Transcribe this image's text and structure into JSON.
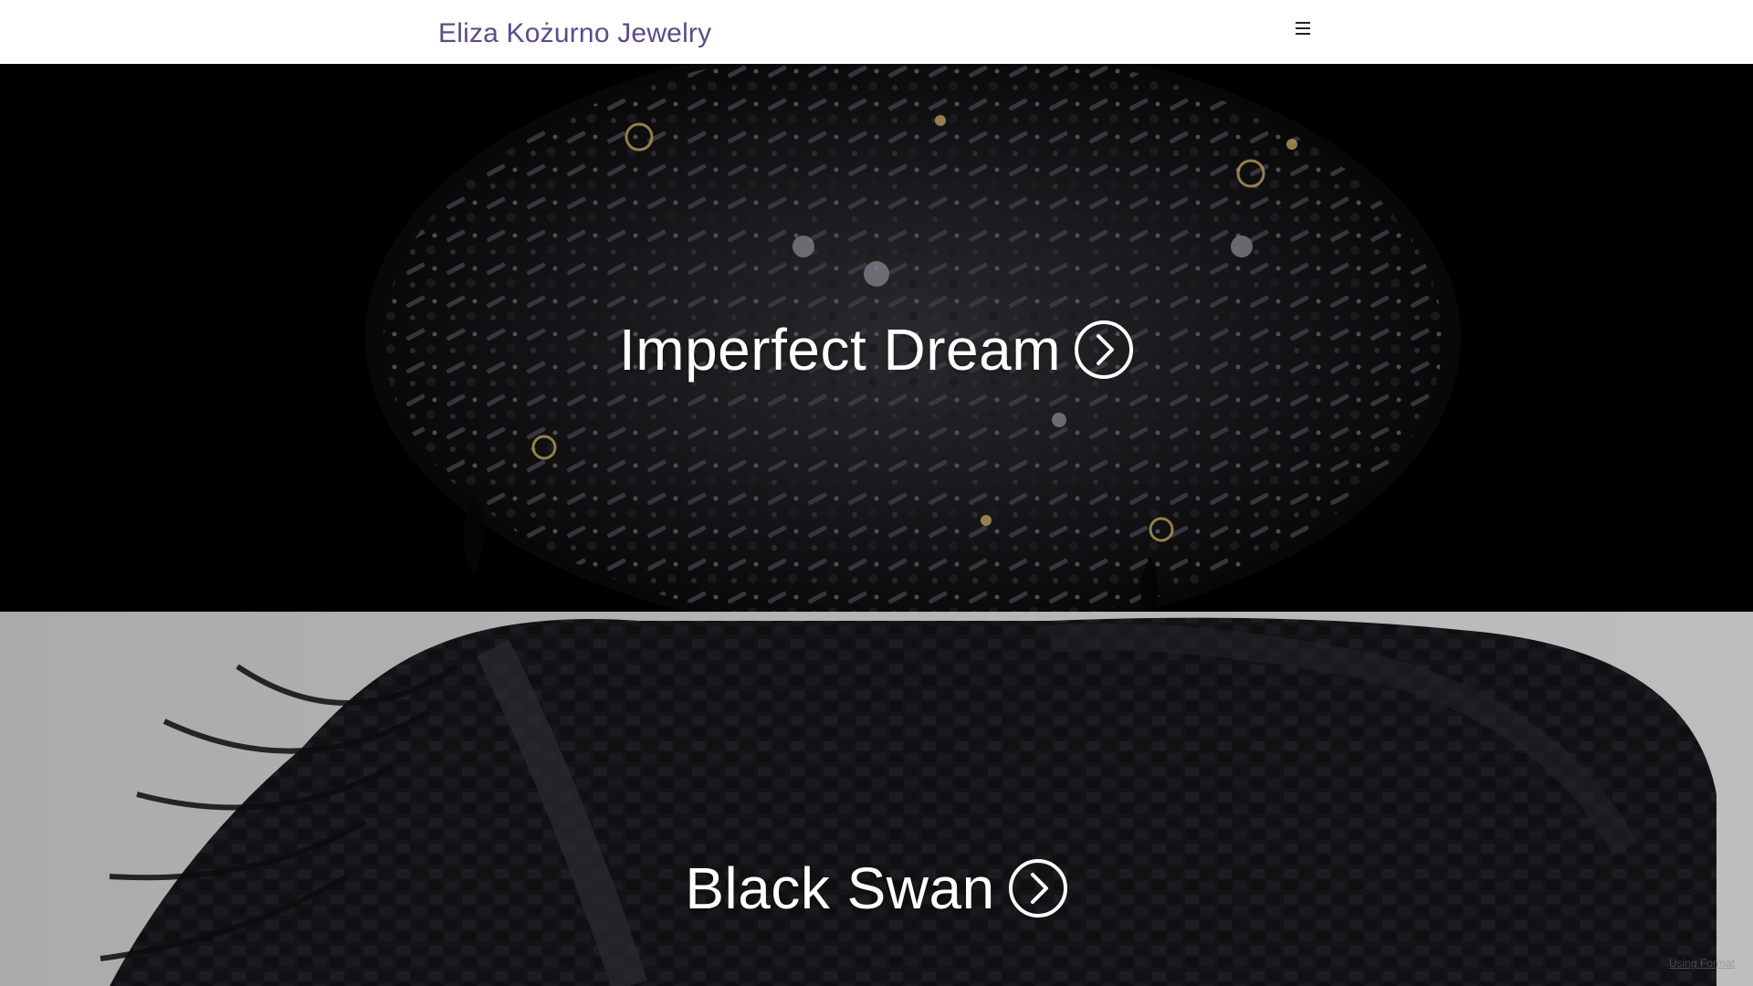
{
  "header": {
    "site_title": "Eliza Kożurno Jewelry",
    "menu_icon": "hamburger-menu-icon"
  },
  "panels": [
    {
      "title": "Imperfect Dream",
      "icon": "circle-chevron-right-icon"
    },
    {
      "title": "Black Swan",
      "icon": "circle-chevron-right-icon"
    }
  ],
  "footer": {
    "credit": "Using Format"
  },
  "colors": {
    "title_color": "#5d4a8a",
    "header_bg": "#ffffff",
    "panel1_bg": "#000000",
    "panel2_bg": "#a9abab",
    "overlay_text": "#ffffff"
  }
}
